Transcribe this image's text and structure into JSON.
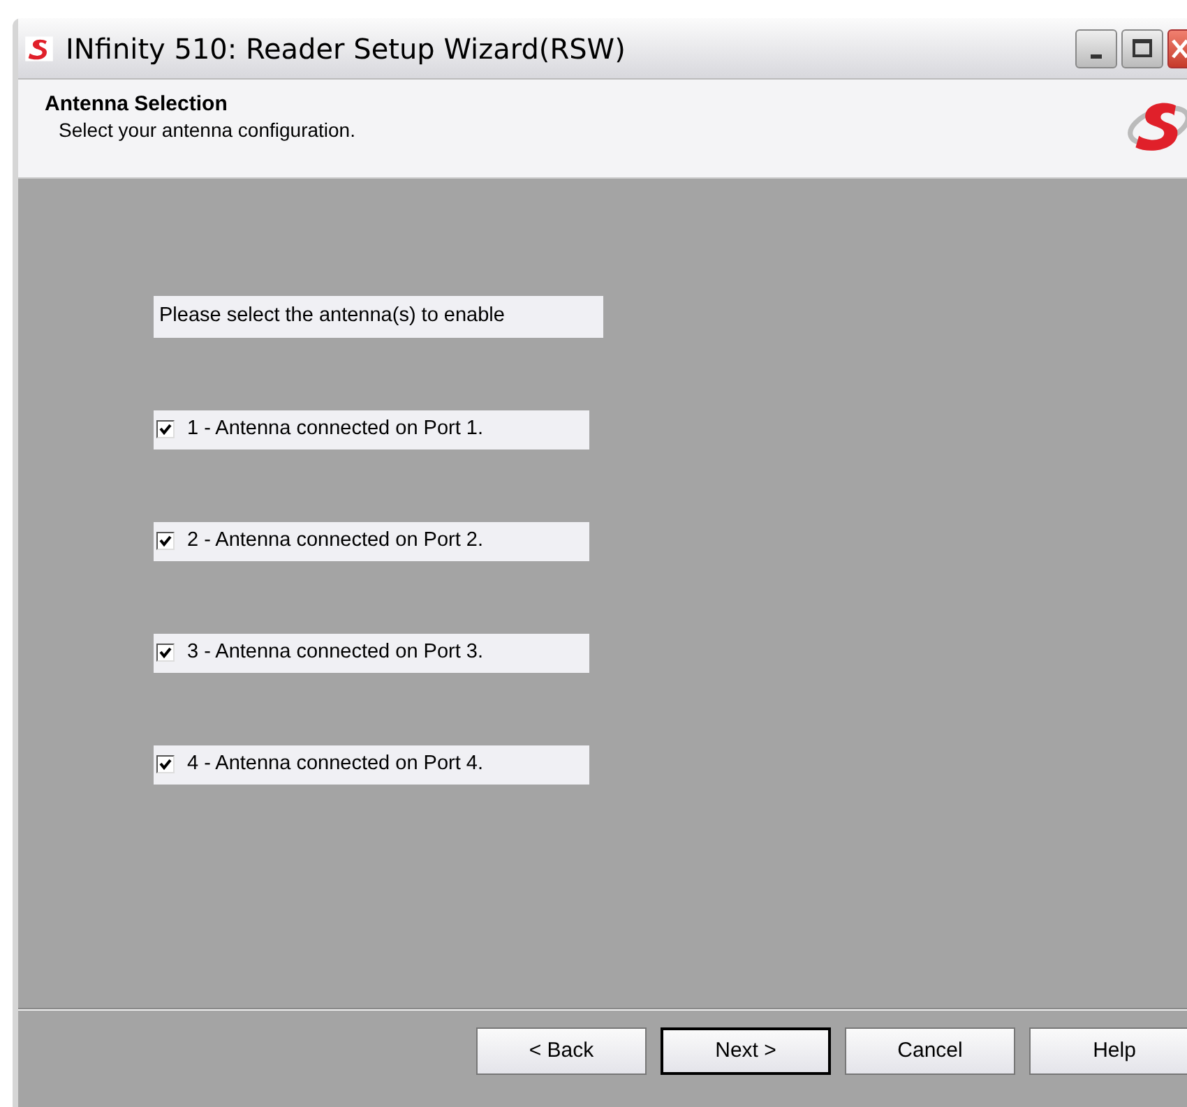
{
  "window": {
    "title": "INfinity 510: Reader Setup Wizard(RSW)"
  },
  "header": {
    "title": "Antenna Selection",
    "subtitle": "Select your antenna configuration."
  },
  "prompt": "Please select the antenna(s) to enable",
  "antennas": [
    {
      "label": "1 - Antenna connected on Port 1.",
      "checked": true
    },
    {
      "label": "2 - Antenna connected on Port 2.",
      "checked": true
    },
    {
      "label": "3 - Antenna connected on Port 3.",
      "checked": true
    },
    {
      "label": "4 - Antenna connected on Port 4.",
      "checked": true
    }
  ],
  "buttons": [
    {
      "label": "< Back",
      "selected": false
    },
    {
      "label": "Next >",
      "selected": true
    },
    {
      "label": "Cancel",
      "selected": false
    },
    {
      "label": "Help",
      "selected": false
    }
  ]
}
